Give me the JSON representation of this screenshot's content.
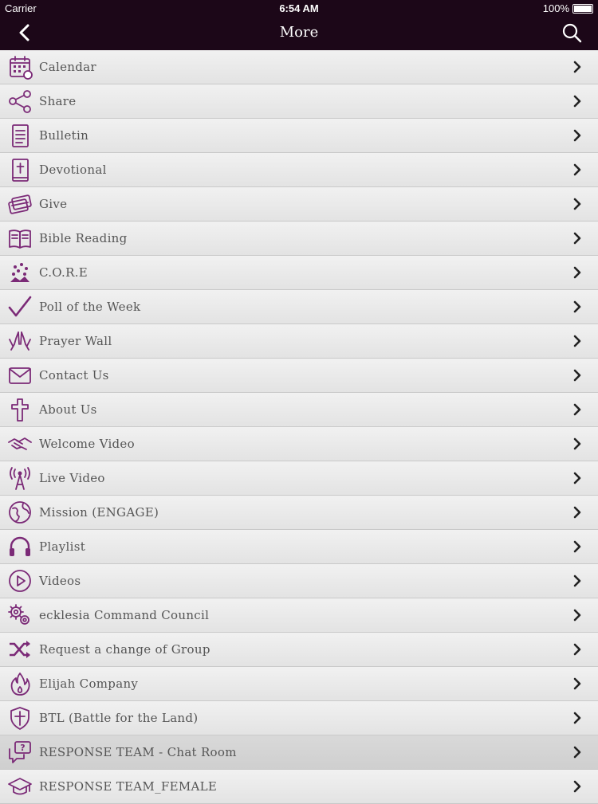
{
  "status": {
    "carrier": "Carrier",
    "time": "6:54 AM",
    "battery": "100%"
  },
  "nav": {
    "title": "More"
  },
  "theme": {
    "bar": "#1c0718",
    "accent": "#7b2a77"
  },
  "items": [
    {
      "label": "Calendar",
      "icon": "calendar-icon"
    },
    {
      "label": "Share",
      "icon": "share-icon"
    },
    {
      "label": "Bulletin",
      "icon": "document-icon"
    },
    {
      "label": "Devotional",
      "icon": "bible-icon"
    },
    {
      "label": "Give",
      "icon": "cards-icon"
    },
    {
      "label": "Bible Reading",
      "icon": "open-book-icon"
    },
    {
      "label": "C.O.R.E",
      "icon": "core-icon"
    },
    {
      "label": "Poll of the Week",
      "icon": "checkmark-icon"
    },
    {
      "label": "Prayer Wall",
      "icon": "praying-hands-icon"
    },
    {
      "label": "Contact Us",
      "icon": "envelope-icon"
    },
    {
      "label": "About Us",
      "icon": "cross-icon"
    },
    {
      "label": "Welcome Video",
      "icon": "handshake-icon"
    },
    {
      "label": "Live Video",
      "icon": "broadcast-tower-icon"
    },
    {
      "label": "Mission (ENGAGE)",
      "icon": "globe-icon"
    },
    {
      "label": "Playlist",
      "icon": "headphones-icon"
    },
    {
      "label": "Videos",
      "icon": "play-circle-icon"
    },
    {
      "label": "ecklesia Command Council",
      "icon": "gears-icon"
    },
    {
      "label": "Request a change of Group",
      "icon": "shuffle-icon"
    },
    {
      "label": "Elijah Company",
      "icon": "flame-icon"
    },
    {
      "label": "BTL  (Battle for the Land)",
      "icon": "shield-icon"
    },
    {
      "label": "RESPONSE TEAM - Chat Room",
      "icon": "chat-icon"
    },
    {
      "label": "RESPONSE TEAM_FEMALE",
      "icon": "graduation-cap-icon"
    }
  ]
}
